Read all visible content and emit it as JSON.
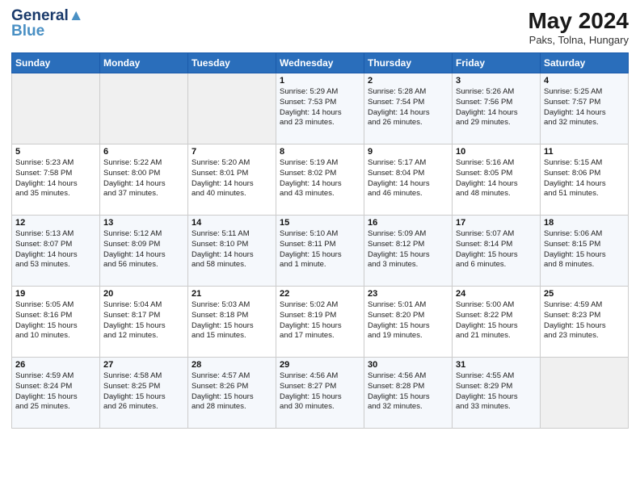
{
  "header": {
    "logo_line1": "General",
    "logo_line2": "Blue",
    "month_year": "May 2024",
    "location": "Paks, Tolna, Hungary"
  },
  "days_of_week": [
    "Sunday",
    "Monday",
    "Tuesday",
    "Wednesday",
    "Thursday",
    "Friday",
    "Saturday"
  ],
  "weeks": [
    [
      {
        "day": "",
        "text": ""
      },
      {
        "day": "",
        "text": ""
      },
      {
        "day": "",
        "text": ""
      },
      {
        "day": "1",
        "text": "Sunrise: 5:29 AM\nSunset: 7:53 PM\nDaylight: 14 hours\nand 23 minutes."
      },
      {
        "day": "2",
        "text": "Sunrise: 5:28 AM\nSunset: 7:54 PM\nDaylight: 14 hours\nand 26 minutes."
      },
      {
        "day": "3",
        "text": "Sunrise: 5:26 AM\nSunset: 7:56 PM\nDaylight: 14 hours\nand 29 minutes."
      },
      {
        "day": "4",
        "text": "Sunrise: 5:25 AM\nSunset: 7:57 PM\nDaylight: 14 hours\nand 32 minutes."
      }
    ],
    [
      {
        "day": "5",
        "text": "Sunrise: 5:23 AM\nSunset: 7:58 PM\nDaylight: 14 hours\nand 35 minutes."
      },
      {
        "day": "6",
        "text": "Sunrise: 5:22 AM\nSunset: 8:00 PM\nDaylight: 14 hours\nand 37 minutes."
      },
      {
        "day": "7",
        "text": "Sunrise: 5:20 AM\nSunset: 8:01 PM\nDaylight: 14 hours\nand 40 minutes."
      },
      {
        "day": "8",
        "text": "Sunrise: 5:19 AM\nSunset: 8:02 PM\nDaylight: 14 hours\nand 43 minutes."
      },
      {
        "day": "9",
        "text": "Sunrise: 5:17 AM\nSunset: 8:04 PM\nDaylight: 14 hours\nand 46 minutes."
      },
      {
        "day": "10",
        "text": "Sunrise: 5:16 AM\nSunset: 8:05 PM\nDaylight: 14 hours\nand 48 minutes."
      },
      {
        "day": "11",
        "text": "Sunrise: 5:15 AM\nSunset: 8:06 PM\nDaylight: 14 hours\nand 51 minutes."
      }
    ],
    [
      {
        "day": "12",
        "text": "Sunrise: 5:13 AM\nSunset: 8:07 PM\nDaylight: 14 hours\nand 53 minutes."
      },
      {
        "day": "13",
        "text": "Sunrise: 5:12 AM\nSunset: 8:09 PM\nDaylight: 14 hours\nand 56 minutes."
      },
      {
        "day": "14",
        "text": "Sunrise: 5:11 AM\nSunset: 8:10 PM\nDaylight: 14 hours\nand 58 minutes."
      },
      {
        "day": "15",
        "text": "Sunrise: 5:10 AM\nSunset: 8:11 PM\nDaylight: 15 hours\nand 1 minute."
      },
      {
        "day": "16",
        "text": "Sunrise: 5:09 AM\nSunset: 8:12 PM\nDaylight: 15 hours\nand 3 minutes."
      },
      {
        "day": "17",
        "text": "Sunrise: 5:07 AM\nSunset: 8:14 PM\nDaylight: 15 hours\nand 6 minutes."
      },
      {
        "day": "18",
        "text": "Sunrise: 5:06 AM\nSunset: 8:15 PM\nDaylight: 15 hours\nand 8 minutes."
      }
    ],
    [
      {
        "day": "19",
        "text": "Sunrise: 5:05 AM\nSunset: 8:16 PM\nDaylight: 15 hours\nand 10 minutes."
      },
      {
        "day": "20",
        "text": "Sunrise: 5:04 AM\nSunset: 8:17 PM\nDaylight: 15 hours\nand 12 minutes."
      },
      {
        "day": "21",
        "text": "Sunrise: 5:03 AM\nSunset: 8:18 PM\nDaylight: 15 hours\nand 15 minutes."
      },
      {
        "day": "22",
        "text": "Sunrise: 5:02 AM\nSunset: 8:19 PM\nDaylight: 15 hours\nand 17 minutes."
      },
      {
        "day": "23",
        "text": "Sunrise: 5:01 AM\nSunset: 8:20 PM\nDaylight: 15 hours\nand 19 minutes."
      },
      {
        "day": "24",
        "text": "Sunrise: 5:00 AM\nSunset: 8:22 PM\nDaylight: 15 hours\nand 21 minutes."
      },
      {
        "day": "25",
        "text": "Sunrise: 4:59 AM\nSunset: 8:23 PM\nDaylight: 15 hours\nand 23 minutes."
      }
    ],
    [
      {
        "day": "26",
        "text": "Sunrise: 4:59 AM\nSunset: 8:24 PM\nDaylight: 15 hours\nand 25 minutes."
      },
      {
        "day": "27",
        "text": "Sunrise: 4:58 AM\nSunset: 8:25 PM\nDaylight: 15 hours\nand 26 minutes."
      },
      {
        "day": "28",
        "text": "Sunrise: 4:57 AM\nSunset: 8:26 PM\nDaylight: 15 hours\nand 28 minutes."
      },
      {
        "day": "29",
        "text": "Sunrise: 4:56 AM\nSunset: 8:27 PM\nDaylight: 15 hours\nand 30 minutes."
      },
      {
        "day": "30",
        "text": "Sunrise: 4:56 AM\nSunset: 8:28 PM\nDaylight: 15 hours\nand 32 minutes."
      },
      {
        "day": "31",
        "text": "Sunrise: 4:55 AM\nSunset: 8:29 PM\nDaylight: 15 hours\nand 33 minutes."
      },
      {
        "day": "",
        "text": ""
      }
    ]
  ]
}
